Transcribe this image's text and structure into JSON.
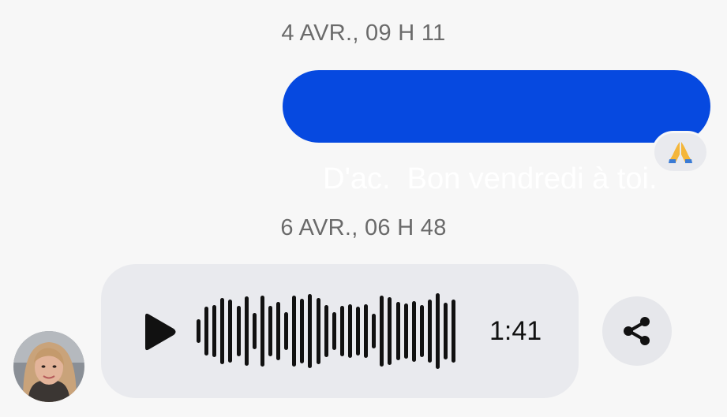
{
  "conversation": {
    "timestamps": [
      "4 AVR., 09 H 11",
      "6 AVR., 06 H 48"
    ],
    "sent_message": {
      "text": "D'ac.  Bon vendredi à toi.",
      "color": "#0649e0",
      "reaction_emoji": "🙏"
    },
    "voice_message": {
      "duration": "1:41",
      "play_icon": "play-icon",
      "waveform_levels": [
        0.28,
        0.56,
        0.6,
        0.76,
        0.72,
        0.58,
        0.8,
        0.42,
        0.82,
        0.58,
        0.68,
        0.44,
        0.82,
        0.74,
        0.86,
        0.76,
        0.6,
        0.44,
        0.58,
        0.62,
        0.56,
        0.62,
        0.4,
        0.82,
        0.78,
        0.68,
        0.64,
        0.7,
        0.6,
        0.72,
        0.88,
        0.66,
        0.72
      ]
    },
    "share_icon": "share-icon",
    "avatar": "contact-avatar"
  }
}
